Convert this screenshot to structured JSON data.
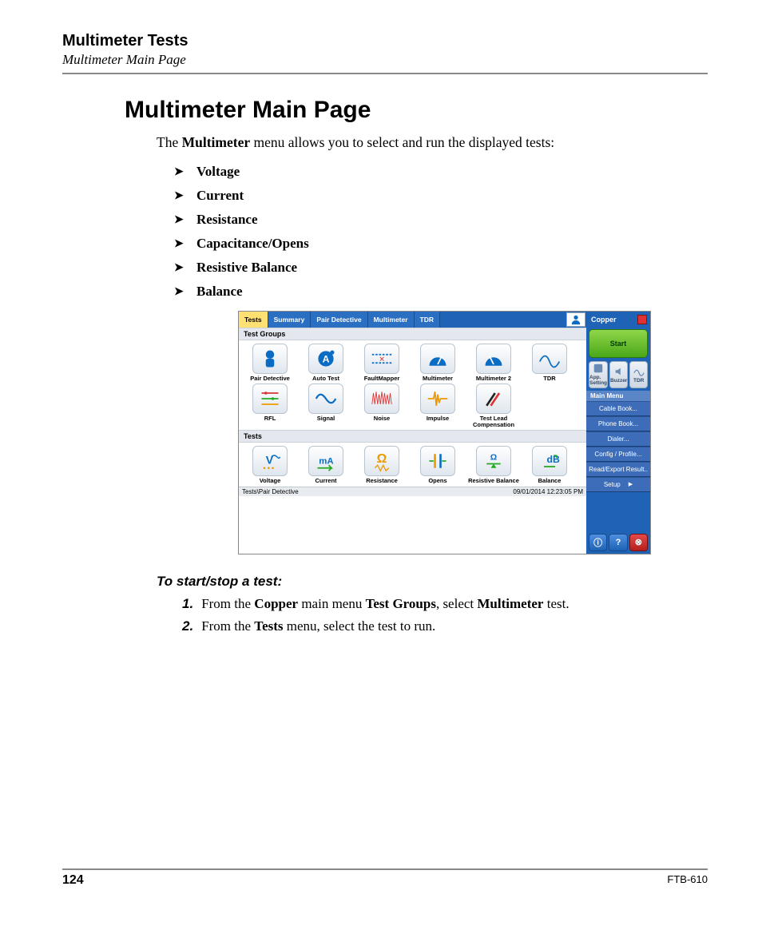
{
  "header": {
    "title": "Multimeter Tests",
    "subtitle": "Multimeter Main Page"
  },
  "section_title": "Multimeter Main Page",
  "intro": {
    "pre": "The ",
    "bold": "Multimeter",
    "post": " menu allows you to select and run the displayed tests:"
  },
  "bullets": [
    "Voltage",
    "Current",
    "Resistance",
    "Capacitance/Opens",
    "Resistive Balance",
    "Balance"
  ],
  "screenshot": {
    "tabs": [
      "Tests",
      "Summary",
      "Pair Detective",
      "Multimeter",
      "TDR"
    ],
    "active_tab_index": 0,
    "group_label": "Test Groups",
    "groups": [
      "Pair Detective",
      "Auto Test",
      "FaultMapper",
      "Multimeter",
      "Multimeter 2",
      "TDR",
      "RFL",
      "Signal",
      "Noise",
      "Impulse",
      "Test Lead Compensation"
    ],
    "tests_label": "Tests",
    "tests": [
      "Voltage",
      "Current",
      "Resistance",
      "Opens",
      "Resistive Balance",
      "Balance"
    ],
    "status_left": "Tests\\Pair Detective",
    "status_right": "09/01/2014 12:23:05 PM",
    "side": {
      "title": "Copper",
      "start": "Start",
      "utils": [
        "App. Setting",
        "Buzzer",
        "TDR"
      ],
      "menu_head": "Main Menu",
      "menu": [
        "Cable Book...",
        "Phone Book...",
        "Dialer...",
        "Config / Profile...",
        "Read/Export Result..",
        "Setup"
      ],
      "setup_arrow": "▶"
    }
  },
  "instructions": {
    "heading": "To start/stop a test:",
    "steps": [
      {
        "num": "1.",
        "parts": [
          "From the ",
          "Copper",
          " main menu ",
          "Test Groups",
          ", select ",
          "Multimeter",
          " test."
        ]
      },
      {
        "num": "2.",
        "parts": [
          "From the ",
          "Tests",
          " menu, select the test to run."
        ]
      }
    ]
  },
  "footer": {
    "page": "124",
    "model": "FTB-610"
  }
}
